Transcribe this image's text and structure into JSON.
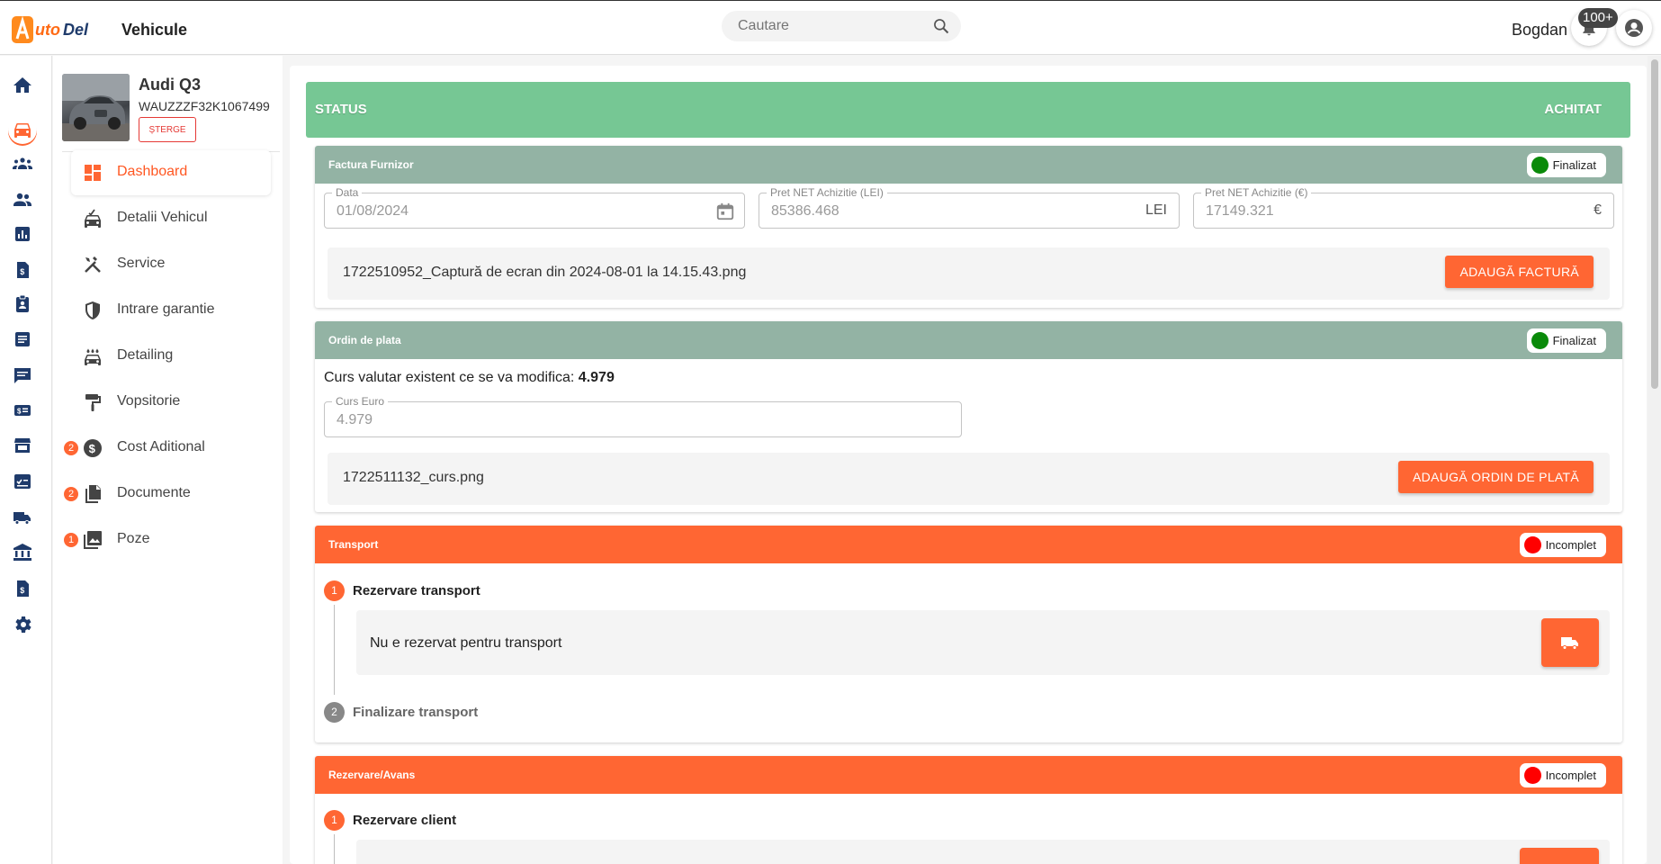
{
  "header": {
    "logo_text": "AutoDel",
    "title": "Vehicule",
    "search_placeholder": "Cautare",
    "username": "Bogdan",
    "notifications_badge": "100+"
  },
  "rail": {
    "icons": [
      "home-icon",
      "car-icon",
      "groups-icon",
      "people-icon",
      "chart-icon",
      "money-doc-icon",
      "badge-icon",
      "article-icon",
      "chat-icon",
      "payments-icon",
      "store-icon",
      "checklist-icon",
      "truck-icon",
      "bank-icon",
      "invoice-icon",
      "settings-icon"
    ],
    "active_index": 1
  },
  "vehicle": {
    "name": "Audi Q3",
    "vin": "WAUZZZF32K1067499",
    "delete_label": "ȘTERGE"
  },
  "nav": {
    "items": [
      {
        "label": "Dashboard",
        "icon": "dashboard-icon",
        "active": true
      },
      {
        "label": "Detalii Vehicul",
        "icon": "car-details-icon"
      },
      {
        "label": "Service",
        "icon": "tools-icon"
      },
      {
        "label": "Intrare garantie",
        "icon": "shield-icon"
      },
      {
        "label": "Detailing",
        "icon": "car-wash-icon"
      },
      {
        "label": "Vopsitorie",
        "icon": "paint-roller-icon"
      },
      {
        "label": "Cost Aditional",
        "icon": "dollar-icon",
        "count": "2"
      },
      {
        "label": "Documente",
        "icon": "documents-icon",
        "count": "2"
      },
      {
        "label": "Poze",
        "icon": "photos-icon",
        "count": "1"
      }
    ]
  },
  "status": {
    "label": "STATUS",
    "value": "ACHITAT",
    "color": "#76c794"
  },
  "factura": {
    "title": "Factura Furnizor",
    "state": "Finalizat",
    "state_color": "#0a8a0a",
    "date_label": "Data",
    "date_value": "01/08/2024",
    "pret_lei_label": "Pret NET Achizitie (LEI)",
    "pret_lei_value": "85386.468",
    "pret_lei_suffix": "LEI",
    "pret_eur_label": "Pret NET Achizitie (€)",
    "pret_eur_value": "17149.321",
    "pret_eur_suffix": "€",
    "file_name": "1722510952_Captură de ecran din 2024-08-01 la 14.15.43.png",
    "button_label": "ADAUGĂ FACTURĂ"
  },
  "ordin": {
    "title": "Ordin de plata",
    "state": "Finalizat",
    "state_color": "#0a8a0a",
    "curs_text": "Curs valutar existent ce se va modifica:",
    "curs_value": "4.979",
    "curs_label": "Curs Euro",
    "curs_field_value": "4.979",
    "file_name": "1722511132_curs.png",
    "button_label": "ADAUGĂ ORDIN DE PLATĂ"
  },
  "transport": {
    "title": "Transport",
    "state": "Incomplet",
    "state_color": "#ff0000",
    "steps": [
      {
        "num": "1",
        "title": "Rezervare transport",
        "text": "Nu e rezervat pentru transport"
      },
      {
        "num": "2",
        "title": "Finalizare transport"
      }
    ]
  },
  "rezervare": {
    "title": "Rezervare/Avans",
    "state": "Incomplet",
    "state_color": "#ff0000",
    "steps": [
      {
        "num": "1",
        "title": "Rezervare client"
      }
    ]
  },
  "colors": {
    "accent": "#ff6633",
    "card_header_grey": "#93b3a4"
  }
}
